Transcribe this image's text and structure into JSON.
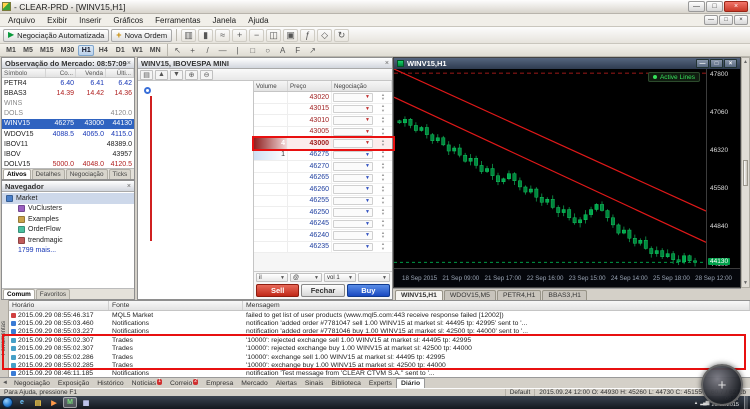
{
  "window": {
    "title": "- CLEAR-PRD - [WINV15,H1]"
  },
  "icons": {
    "minimize": "—",
    "maximize": "□",
    "close": "×",
    "tab_scroll": "◄",
    "tray_arrow": "▴",
    "magnifier_plus": "+"
  },
  "menu": {
    "items": [
      "Arquivo",
      "Exibir",
      "Inserir",
      "Gráficos",
      "Ferramentas",
      "Janela",
      "Ajuda"
    ]
  },
  "toolbar": {
    "autotrade": "Negociação Automatizada",
    "new_order": "Nova Ordem",
    "icons": [
      {
        "name": "bars-chart-icon",
        "glyph": "▥"
      },
      {
        "name": "candles-chart-icon",
        "glyph": "▮"
      },
      {
        "name": "line-chart-icon",
        "glyph": "≈"
      },
      {
        "name": "zoom-in-icon",
        "glyph": "+"
      },
      {
        "name": "zoom-out-icon",
        "glyph": "−"
      },
      {
        "name": "tile-windows-icon",
        "glyph": "◫"
      },
      {
        "name": "new-chart-icon",
        "glyph": "▣"
      },
      {
        "name": "indicators-icon",
        "glyph": "ƒ"
      },
      {
        "name": "objects-icon",
        "glyph": "◇"
      },
      {
        "name": "refresh-icon",
        "glyph": "↻"
      }
    ]
  },
  "timeframes": {
    "items": [
      "M1",
      "M5",
      "M15",
      "M30",
      "H1",
      "H4",
      "D1",
      "W1",
      "MN"
    ],
    "active": "H1",
    "tools": [
      {
        "name": "cursor-icon",
        "glyph": "↖"
      },
      {
        "name": "crosshair-icon",
        "glyph": "+"
      },
      {
        "name": "trendline-icon",
        "glyph": "/"
      },
      {
        "name": "horizontal-line-icon",
        "glyph": "—"
      },
      {
        "name": "vertical-line-icon",
        "glyph": "|"
      },
      {
        "name": "rectangle-icon",
        "glyph": "□"
      },
      {
        "name": "ellipse-icon",
        "glyph": "○"
      },
      {
        "name": "text-icon",
        "glyph": "A"
      },
      {
        "name": "fibonacci-icon",
        "glyph": "F"
      },
      {
        "name": "arrow-icon",
        "glyph": "↗"
      }
    ]
  },
  "market_watch": {
    "title": "Observação do Mercado: 08:57:09",
    "columns": [
      "Símbolo",
      "Co...",
      "Venda",
      "Últi..."
    ],
    "rows": [
      {
        "symbol": "PETR4",
        "bid": "6.40",
        "ask": "6.41",
        "last": "6.42",
        "tone": "blue"
      },
      {
        "symbol": "BBAS3",
        "bid": "14.39",
        "ask": "14.42",
        "last": "14.36",
        "tone": "red"
      },
      {
        "symbol": "WINS",
        "bid": "",
        "ask": "",
        "last": "",
        "tone": "dim"
      },
      {
        "symbol": "DOLS",
        "bid": "",
        "ask": "",
        "last": "4120.0",
        "tone": "dim"
      },
      {
        "symbol": "WINV15",
        "bid": "46275",
        "ask": "43000",
        "last": "44130",
        "state": "selected"
      },
      {
        "symbol": "WDOV15",
        "bid": "4088.5",
        "ask": "4065.0",
        "last": "4115.0",
        "tone": "blue"
      },
      {
        "symbol": "IBOV11",
        "bid": "",
        "ask": "",
        "last": "48389.0",
        "tone": ""
      },
      {
        "symbol": "IBOV",
        "bid": "",
        "ask": "",
        "last": "43957",
        "tone": ""
      },
      {
        "symbol": "DOLV15",
        "bid": "5000.0",
        "ask": "4048.0",
        "last": "4120.5",
        "tone": "red"
      }
    ],
    "tabs": [
      "Ativos",
      "Detalhes",
      "Negociação",
      "Ticks"
    ],
    "active_tab": "Ativos"
  },
  "navigator": {
    "title": "Navegador",
    "items": [
      {
        "label": "Market",
        "icon": "market-icon",
        "color": "#4a7fc9",
        "selected": true,
        "depth": 0
      },
      {
        "label": "VuClusters",
        "icon": "product-icon",
        "color": "#9a5fc0",
        "depth": 1
      },
      {
        "label": "Examples",
        "icon": "product-icon",
        "color": "#c9a24a",
        "depth": 1
      },
      {
        "label": "OrderFlow",
        "icon": "product-icon",
        "color": "#4ac0a0",
        "depth": 1
      },
      {
        "label": "trendmagic",
        "icon": "product-icon",
        "color": "#c05a5a",
        "depth": 1
      },
      {
        "label": "1799 mais...",
        "link": true,
        "depth": 1
      }
    ],
    "tabs": [
      "Comum",
      "Favoritos"
    ],
    "active_tab": "Comum"
  },
  "dom": {
    "title": "WINV15, IBOVESPA MINI",
    "icons": [
      {
        "name": "depth-book-icon",
        "glyph": "▤"
      },
      {
        "name": "orders-up-icon",
        "glyph": "▲"
      },
      {
        "name": "orders-down-icon",
        "glyph": "▼"
      },
      {
        "name": "zoom-in-icon",
        "glyph": "⊕"
      },
      {
        "name": "zoom-out-icon",
        "glyph": "⊖"
      }
    ],
    "columns": [
      "Volume",
      "Preço",
      "Negociação"
    ],
    "rows": [
      {
        "volume": "",
        "price": "43020",
        "side": "ask"
      },
      {
        "volume": "",
        "price": "43015",
        "side": "ask"
      },
      {
        "volume": "",
        "price": "43010",
        "side": "ask"
      },
      {
        "volume": "",
        "price": "43005",
        "side": "ask"
      },
      {
        "volume": "4",
        "price": "43000",
        "side": "ask",
        "highlight": true
      },
      {
        "volume": "1",
        "price": "46275",
        "side": "bid",
        "best": true
      },
      {
        "volume": "",
        "price": "46270",
        "side": "bid"
      },
      {
        "volume": "",
        "price": "46265",
        "side": "bid"
      },
      {
        "volume": "",
        "price": "46260",
        "side": "bid"
      },
      {
        "volume": "",
        "price": "46255",
        "side": "bid"
      },
      {
        "volume": "",
        "price": "46250",
        "side": "bid"
      },
      {
        "volume": "",
        "price": "46245",
        "side": "bid"
      },
      {
        "volume": "",
        "price": "46240",
        "side": "bid"
      },
      {
        "volume": "",
        "price": "46235",
        "side": "bid"
      }
    ],
    "controls": [
      {
        "label": "il"
      },
      {
        "label": "@"
      },
      {
        "label": "vol 1"
      },
      {
        "label": ""
      }
    ],
    "sell_label": "Sell",
    "close_label": "Fechar",
    "buy_label": "Buy"
  },
  "chart": {
    "title": "WINV15,H1",
    "badge": "Active Lines",
    "tabs": [
      "WINV15,H1",
      "WDOV15,M5",
      "PETR4,H1",
      "BBAS3,H1"
    ],
    "active_tab": "WINV15,H1"
  },
  "chart_data": {
    "type": "candlestick",
    "symbol": "WINV15,H1",
    "ylim": [
      44000,
      47900
    ],
    "y_ticks": [
      "47800",
      "47060",
      "46320",
      "45580",
      "44840",
      "44100"
    ],
    "x_labels": [
      "18 Sep 2015",
      "21 Sep 09:00",
      "21 Sep 17:00",
      "22 Sep 16:00",
      "23 Sep 15:00",
      "24 Sep 14:00",
      "25 Sep 18:00",
      "28 Sep 12:00"
    ],
    "closes": [
      46850,
      46920,
      46800,
      46700,
      46760,
      46620,
      46500,
      46560,
      46420,
      46300,
      46360,
      46220,
      46100,
      46160,
      46020,
      45900,
      45960,
      45820,
      45700,
      45760,
      45860,
      45720,
      45600,
      45500,
      45560,
      45400,
      45300,
      45360,
      45200,
      45100,
      45160,
      45000,
      44900,
      44960,
      45060,
      45160,
      45260,
      45140,
      45000,
      44860,
      44700,
      44760,
      44600,
      44500,
      44560,
      44400,
      44300,
      44360,
      44240,
      44300,
      44180,
      44140,
      44260,
      44160,
      44130
    ],
    "trendlines": [
      {
        "from": 47900,
        "to": 45130
      },
      {
        "from": 47350,
        "to": 44520
      }
    ],
    "hlines": [
      {
        "price": 44130,
        "color": "#00b050",
        "dash": "3,3"
      },
      {
        "price": 47820,
        "color": "#d02020",
        "dash": "4,3"
      }
    ],
    "last_price": "44130"
  },
  "journal": {
    "side_label": "Ferramentas",
    "columns": [
      "Horário",
      "Fonte",
      "Mensagem"
    ],
    "rows": [
      {
        "time": "2015.09.29 08:55:46.317",
        "source": "MQL5 Market",
        "message": "failed to get list of user products (www.mql5.com:443 receive response failed [12002])",
        "tone": "error"
      },
      {
        "time": "2015.09.29 08:55:03.460",
        "source": "Notifications",
        "message": "notification 'added order #7781047 sell 1.00 WINV15 at market sl: 44495 tp: 42995' sent to '...",
        "tone": "info"
      },
      {
        "time": "2015.09.29 08:55:03.227",
        "source": "Notifications",
        "message": "notification 'added order #7781046 buy 1.00 WINV15 at market sl: 42500 tp: 44000' sent to '...",
        "tone": "info"
      },
      {
        "time": "2015.09.29 08:55:02.307",
        "source": "Trades",
        "message": "'10000': rejected exchange sell 1.00 WINV15 at market sl: 44495 tp: 42995",
        "tone": "trade"
      },
      {
        "time": "2015.09.29 08:55:02.307",
        "source": "Trades",
        "message": "'10000': rejected exchange buy 1.00 WINV15 at market sl: 42500 tp: 44000",
        "tone": "trade"
      },
      {
        "time": "2015.09.29 08:55:02.286",
        "source": "Trades",
        "message": "'10000': exchange sell 1.00 WINV15 at market sl: 44495 tp: 42995",
        "tone": "trade"
      },
      {
        "time": "2015.09.29 08:55:02.285",
        "source": "Trades",
        "message": "'10000': exchange buy 1.00 WINV15 at market sl: 42500 tp: 44000",
        "tone": "trade"
      },
      {
        "time": "2015.09.29 08:46:11.185",
        "source": "Notifications",
        "message": "notification 'Test message from 'CLEAR CTVM S.A.'' sent to '...",
        "tone": "info"
      }
    ]
  },
  "bottom_tabs": {
    "items": [
      {
        "label": "Negociação"
      },
      {
        "label": "Exposição"
      },
      {
        "label": "Histórico"
      },
      {
        "label": "Notícias",
        "badge": "1"
      },
      {
        "label": "Correio",
        "badge": "2"
      },
      {
        "label": "Empresa"
      },
      {
        "label": "Mercado"
      },
      {
        "label": "Alertas"
      },
      {
        "label": "Sinais"
      },
      {
        "label": "Biblioteca"
      },
      {
        "label": "Experts"
      },
      {
        "label": "Diário",
        "active": true
      }
    ]
  },
  "status_bar": {
    "help": "Para Ajuda, pressione F1",
    "profile": "Default",
    "ohlc": "2015.09.24 12:00  O: 44930  H: 45260  L: 44730  C: 45155",
    "traffic": "60.7 / 62 Kb"
  },
  "taskbar": {
    "time": "08:57",
    "date": "29/09/2015",
    "icons": [
      {
        "name": "internet-explorer-icon",
        "glyph": "e",
        "color": "#6ec6ff"
      },
      {
        "name": "explorer-folder-icon",
        "glyph": "▤",
        "color": "#ffd24a"
      },
      {
        "name": "media-player-icon",
        "glyph": "▶",
        "color": "#ff9a4a"
      },
      {
        "name": "metatrader-icon",
        "glyph": "M",
        "color": "#7ae07a",
        "active": true
      },
      {
        "name": "notepad-icon",
        "glyph": "▦",
        "color": "#cfd4ff"
      }
    ]
  }
}
